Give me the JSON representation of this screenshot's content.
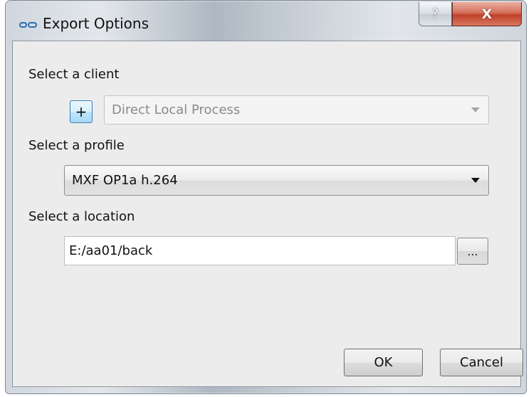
{
  "window": {
    "title": "Export Options",
    "help_glyph": "?",
    "close_glyph": "X"
  },
  "client": {
    "label": "Select a client",
    "add_glyph": "+",
    "selected": "Direct Local Process"
  },
  "profile": {
    "label": "Select a profile",
    "selected": "MXF OP1a h.264"
  },
  "location": {
    "label": "Select a location",
    "value": "E:/aa01/back",
    "browse_label": "..."
  },
  "buttons": {
    "ok": "OK",
    "cancel": "Cancel"
  }
}
